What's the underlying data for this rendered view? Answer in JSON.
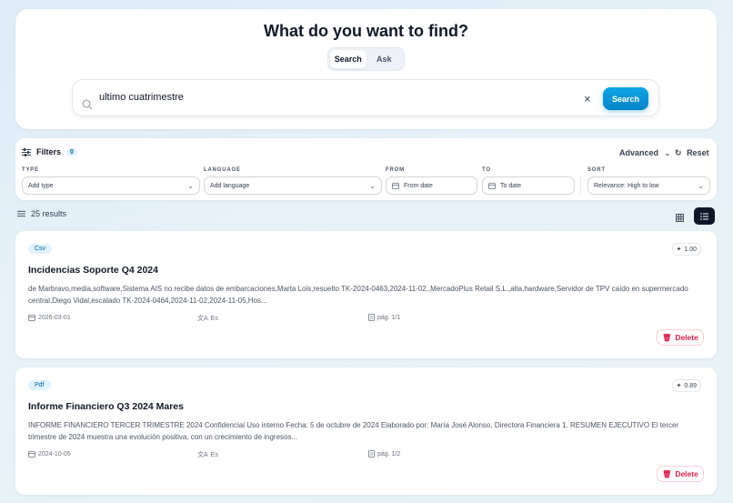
{
  "header": {
    "title": "What do you want to find?"
  },
  "mode_toggle": {
    "search_label": "Search",
    "ask_label": "Ask",
    "active": "search"
  },
  "search": {
    "value": "ultimo cuatrimestre",
    "button_label": "Search",
    "clear_glyph": "×"
  },
  "filters": {
    "label": "Filters",
    "count": "0",
    "advanced_label": "Advanced",
    "reset_label": "Reset",
    "type": {
      "label": "TYPE",
      "placeholder": "Add type"
    },
    "language": {
      "label": "LANGUAGE",
      "placeholder": "Add language"
    },
    "from": {
      "label": "FROM",
      "placeholder": "From date"
    },
    "to": {
      "label": "TO",
      "placeholder": "To date"
    },
    "sort": {
      "label": "SORT",
      "value": "Relevance: High to low"
    }
  },
  "results_bar": {
    "count_label": "25 results",
    "view_mode": "list"
  },
  "results": [
    {
      "type": "Csv",
      "score": "1.00",
      "title": "Incidencias Soporte Q4 2024",
      "snippet": "de Marbravo,media,software,Sistema AIS no recibe datos de embarcaciones,Marta Lois,resuelto TK-2024-0463,2024-11-02,,MercadoPlus Retail S.L.,alta,hardware,Servidor de TPV caído en supermercado central,Diego Vidal,escalado TK-2024-0464,2024-11-02,2024-11-05,Hos...",
      "date": "2026-03-01",
      "language": "Es",
      "pages": "pág. 1/1",
      "delete_label": "Delete"
    },
    {
      "type": "Pdf",
      "score": "0.89",
      "title": "Informe Financiero Q3 2024 Mares",
      "snippet": "INFORME FINANCIERO TERCER TRIMESTRE 2024 Confidencial Uso interno Fecha: 5 de octubre de 2024 Elaborado por: María José Alonso, Directora Financiera 1. RESUMEN EJECUTIVO El tercer trimestre de 2024 muestra una evolución positiva, con un crecimiento de ingresos...",
      "date": "2024-10-05",
      "language": "Es",
      "pages": "pág. 1/2",
      "delete_label": "Delete"
    }
  ],
  "colors": {
    "accent": "#0284c7",
    "danger": "#e11d48",
    "badge_bg": "#e0f2fe"
  }
}
